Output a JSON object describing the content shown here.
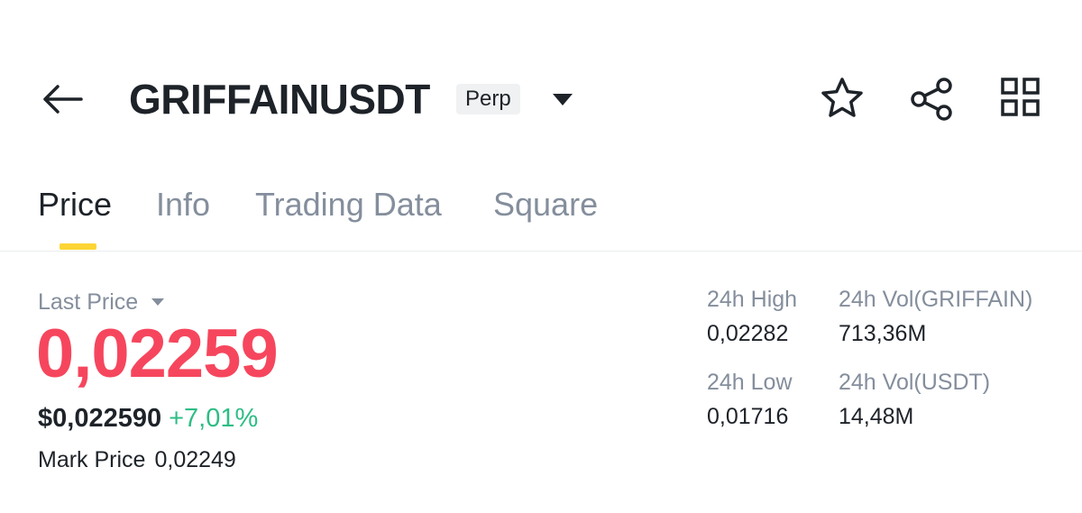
{
  "header": {
    "back_icon": "arrow-left-icon",
    "symbol": "GRIFFAINUSDT",
    "contract_badge": "Perp",
    "dropdown_icon": "caret-down-icon",
    "actions": [
      {
        "name": "favorite",
        "icon": "star-outline-icon"
      },
      {
        "name": "share",
        "icon": "share-icon"
      },
      {
        "name": "more",
        "icon": "grid-icon"
      }
    ]
  },
  "tabs": [
    {
      "label": "Price",
      "active": true
    },
    {
      "label": "Info",
      "active": false
    },
    {
      "label": "Trading Data",
      "active": false
    },
    {
      "label": "Square",
      "active": false
    }
  ],
  "price_panel": {
    "last_price_label": "Last Price",
    "last_price": "0,02259",
    "usd_price": "$0,022590",
    "change_pct": "+7,01%",
    "mark_price_label": "Mark Price",
    "mark_price": "0,02249"
  },
  "stats": {
    "high_label": "24h High",
    "high_value": "0,02282",
    "vol_base_label": "24h Vol(GRIFFAIN)",
    "vol_base_value": "713,36M",
    "low_label": "24h Low",
    "low_value": "0,01716",
    "vol_quote_label": "24h Vol(USDT)",
    "vol_quote_value": "14,48M"
  },
  "colors": {
    "price_down_red": "#f6465d",
    "change_up_green": "#2ebd85",
    "tab_indicator_yellow": "#fcd535",
    "muted_text": "#848e9c",
    "primary_text": "#1e2329",
    "badge_bg": "#f0f1f2"
  }
}
